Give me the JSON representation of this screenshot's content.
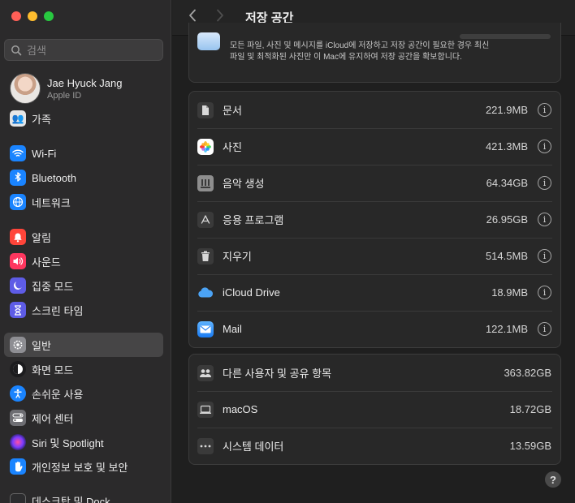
{
  "window": {
    "title": "저장 공간"
  },
  "search": {
    "placeholder": "검색"
  },
  "account": {
    "name": "Jae Hyuck Jang",
    "subtitle": "Apple ID"
  },
  "sidebar": {
    "items": [
      {
        "label": "가족",
        "icon": "family-icon",
        "color": "#2d2d2d"
      },
      {
        "label": "Wi-Fi",
        "icon": "wifi-icon",
        "color": "#1a84ff"
      },
      {
        "label": "Bluetooth",
        "icon": "bluetooth-icon",
        "color": "#1a84ff"
      },
      {
        "label": "네트워크",
        "icon": "globe-icon",
        "color": "#1a84ff"
      },
      {
        "label": "알림",
        "icon": "bell-icon",
        "color": "#ff453a"
      },
      {
        "label": "사운드",
        "icon": "speaker-icon",
        "color": "#ff375f"
      },
      {
        "label": "집중 모드",
        "icon": "moon-icon",
        "color": "#5e5ce6"
      },
      {
        "label": "스크린 타임",
        "icon": "hourglass-icon",
        "color": "#5e5ce6"
      },
      {
        "label": "일반",
        "icon": "gear-icon",
        "color": "#8e8e93"
      },
      {
        "label": "화면 모드",
        "icon": "appearance-icon",
        "color": "#1c1c1e"
      },
      {
        "label": "손쉬운 사용",
        "icon": "accessibility-icon",
        "color": "#1a84ff"
      },
      {
        "label": "제어 센터",
        "icon": "control-center-icon",
        "color": "#6e6e73"
      },
      {
        "label": "Siri 및 Spotlight",
        "icon": "siri-icon",
        "color": "#3a3a8c"
      },
      {
        "label": "개인정보 보호 및 보안",
        "icon": "hand-icon",
        "color": "#1a84ff"
      },
      {
        "label": "데스크탑 및 Dock",
        "icon": "dock-icon",
        "color": "#2c2c2e"
      }
    ],
    "active_index": 8
  },
  "main": {
    "description": "모든 파일, 사진 및 메시지를 iCloud에 저장하고 저장 공간이 필요한 경우 최신 파일 및 최적화된 사진만 이 Mac에 유지하여 저장 공간을 확보합니다.",
    "categories": [
      {
        "label": "문서",
        "size": "221.9MB",
        "icon": "document-icon"
      },
      {
        "label": "사진",
        "size": "421.3MB",
        "icon": "photos-icon"
      },
      {
        "label": "음악 생성",
        "size": "64.34GB",
        "icon": "music-creation-icon"
      },
      {
        "label": "응용 프로그램",
        "size": "26.95GB",
        "icon": "app-store-icon"
      },
      {
        "label": "지우기",
        "size": "514.5MB",
        "icon": "trash-icon"
      },
      {
        "label": "iCloud Drive",
        "size": "18.9MB",
        "icon": "icloud-icon"
      },
      {
        "label": "Mail",
        "size": "122.1MB",
        "icon": "mail-icon"
      }
    ],
    "system": [
      {
        "label": "다른 사용자 및 공유 항목",
        "size": "363.82GB",
        "icon": "users-icon"
      },
      {
        "label": "macOS",
        "size": "18.72GB",
        "icon": "laptop-icon"
      },
      {
        "label": "시스템 데이터",
        "size": "13.59GB",
        "icon": "ellipsis-icon"
      }
    ],
    "help_label": "?"
  }
}
